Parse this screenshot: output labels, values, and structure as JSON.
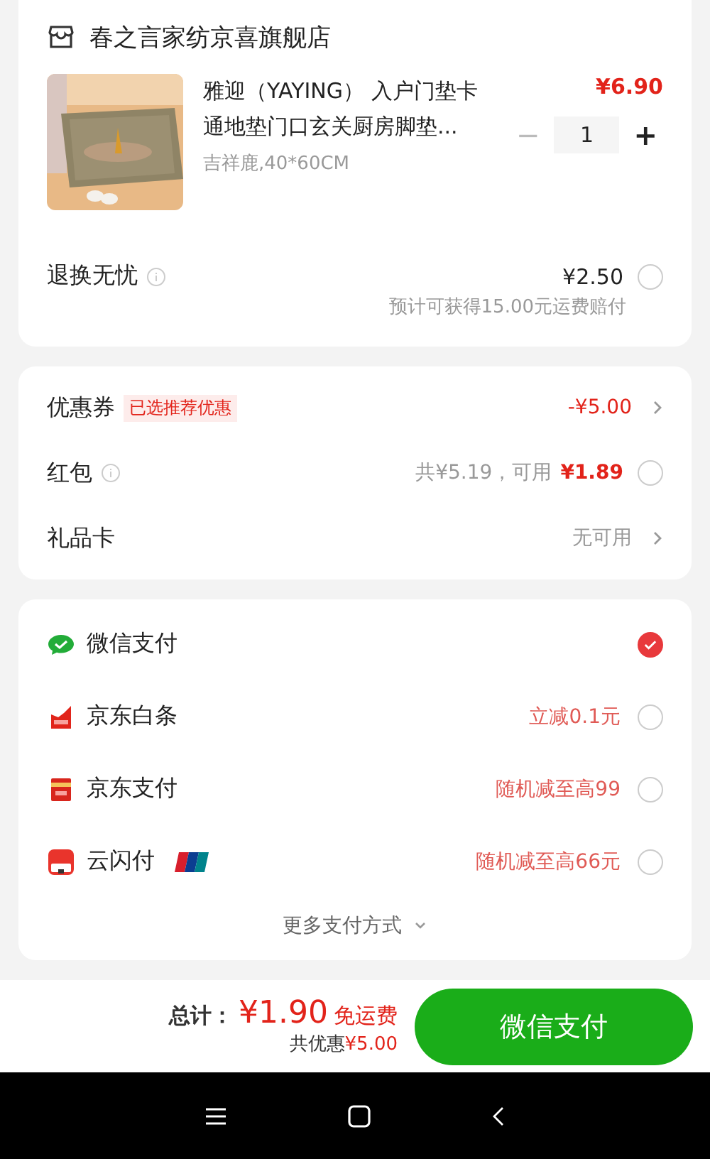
{
  "store": {
    "name": "春之言家纺京喜旗舰店"
  },
  "product": {
    "title": "雅迎（YAYING） 入户门垫卡通地垫门口玄关厨房脚垫...",
    "spec": "吉祥鹿,40*60CM",
    "price": "¥6.90",
    "minus": "−",
    "quantity": "1",
    "plus": "+"
  },
  "service": {
    "label": "退换无忧",
    "price": "¥2.50",
    "checked": false,
    "note": "预计可获得15.00元运费赔付"
  },
  "discounts": [
    {
      "kind": "coupon",
      "label": "优惠券",
      "tag": "已选推荐优惠",
      "value": "-¥5.00"
    },
    {
      "kind": "red_packet",
      "label": "红包",
      "total": "共¥5.19，可用",
      "usable": "¥1.89",
      "checked": false
    },
    {
      "kind": "gift_card",
      "label": "礼品卡",
      "value": "无可用"
    }
  ],
  "payments": [
    {
      "kind": "wechat",
      "name": "微信支付",
      "selected": true
    },
    {
      "kind": "baitiao",
      "name": "京东白条",
      "promo": "立减0.1元",
      "selected": false
    },
    {
      "kind": "jdpay",
      "name": "京东支付",
      "promo": "随机减至高99",
      "selected": false
    },
    {
      "kind": "unionpay",
      "name": "云闪付",
      "promo": "随机减至高66元",
      "selected": false
    }
  ],
  "more_payments": "更多支付方式",
  "footer": {
    "total_label": "总计：",
    "total": "¥1.90",
    "shipping": "免运费",
    "discount_label": "共优惠",
    "discount": "¥5.00",
    "pay_button": "微信支付"
  }
}
